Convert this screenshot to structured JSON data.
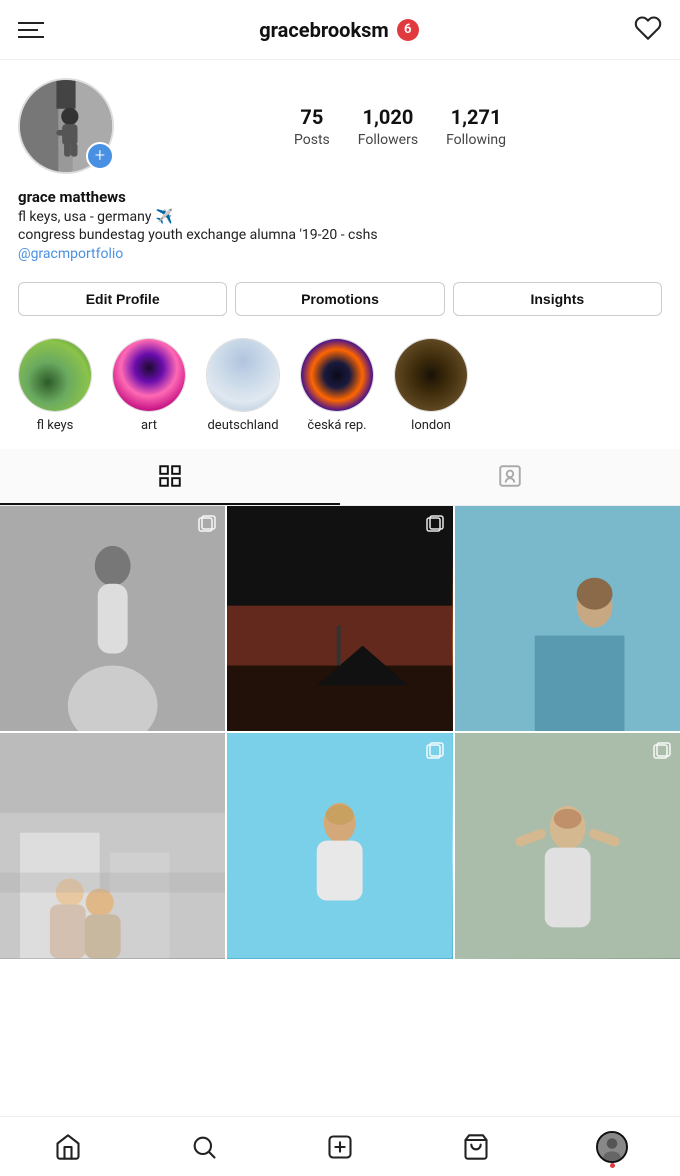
{
  "header": {
    "username": "gracebrooksm",
    "notification_count": "6",
    "menu_label": "menu",
    "heart_label": "notifications"
  },
  "profile": {
    "stats": {
      "posts_count": "75",
      "posts_label": "Posts",
      "followers_count": "1,020",
      "followers_label": "Followers",
      "following_count": "1,271",
      "following_label": "Following"
    },
    "bio": {
      "name": "grace matthews",
      "location": "fl keys, usa - germany",
      "description": "congress bundestag youth exchange alumna '19-20 - cshs",
      "link": "@gracmportfolio"
    }
  },
  "buttons": {
    "edit_profile": "Edit Profile",
    "promotions": "Promotions",
    "insights": "Insights"
  },
  "highlights": [
    {
      "id": "flkeys",
      "label": "fl keys",
      "class": "hl-flkeys"
    },
    {
      "id": "art",
      "label": "art",
      "class": "hl-art"
    },
    {
      "id": "deutschland",
      "label": "deutschland",
      "class": "hl-deutsch"
    },
    {
      "id": "ceska",
      "label": "česká rep.",
      "class": "hl-ceska"
    },
    {
      "id": "london",
      "label": "london",
      "class": "hl-london"
    }
  ],
  "tabs": {
    "grid": "grid-view",
    "tagged": "tagged-view"
  },
  "grid_posts": [
    {
      "id": 1,
      "class": "gi-1",
      "multi": true
    },
    {
      "id": 2,
      "class": "gi-2",
      "multi": true
    },
    {
      "id": 3,
      "class": "gi-3",
      "multi": false
    },
    {
      "id": 4,
      "class": "gi-4",
      "multi": false
    },
    {
      "id": 5,
      "class": "gi-5",
      "multi": true
    },
    {
      "id": 6,
      "class": "gi-6",
      "multi": true
    }
  ],
  "nav": {
    "home": "home",
    "search": "search",
    "create": "create-post",
    "shop": "shop",
    "profile": "profile"
  }
}
